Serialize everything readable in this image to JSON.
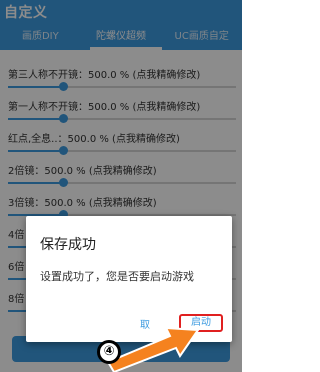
{
  "header": {
    "title": "自定义",
    "tabs": [
      "画质DIY",
      "陀螺仪超频",
      "UC画质自定"
    ],
    "active_tab": 1
  },
  "settings": [
    {
      "label": "第三人称不开镜：",
      "value": "500.0 %",
      "hint": "(点我精确修改)",
      "level": 0.24
    },
    {
      "label": "第一人称不开镜：",
      "value": "500.0 %",
      "hint": "(点我精确修改)",
      "level": 0.24
    },
    {
      "label": "红点,全息..：",
      "value": "500.0 %",
      "hint": "(点我精确修改)",
      "level": 0.24
    },
    {
      "label": "2倍镜：",
      "value": "500.0 %",
      "hint": "(点我精确修改)",
      "level": 0.24
    },
    {
      "label": "3倍镜：",
      "value": "500.0 %",
      "hint": "(点我精确修改)",
      "level": 0.24
    },
    {
      "label": "4倍",
      "value": "",
      "hint": "",
      "level": 0.24
    },
    {
      "label": "6倍",
      "value": "",
      "hint": "",
      "level": 0.24
    },
    {
      "label": "8倍",
      "value": "",
      "hint": "",
      "level": 0.24
    }
  ],
  "dialog": {
    "title": "保存成功",
    "message": "设置成功了，您是否要启动游戏",
    "cancel_label": "取",
    "confirm_label": "启动"
  },
  "annotation": {
    "step": "④"
  },
  "colors": {
    "accent": "#3d9be0",
    "highlight": "#e02020",
    "arrow": "#f5821f"
  }
}
